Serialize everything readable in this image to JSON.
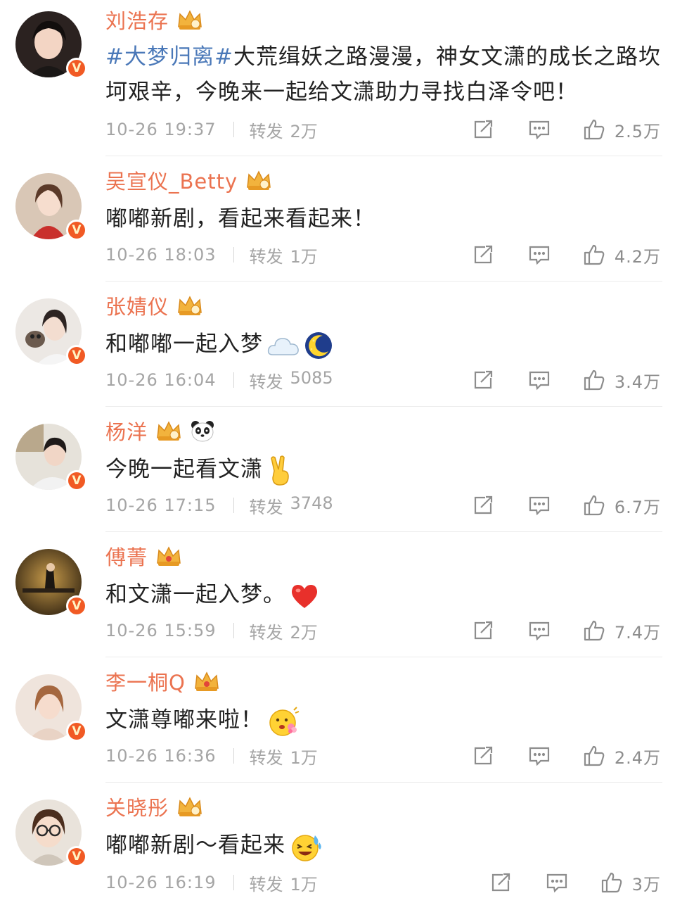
{
  "comments": [
    {
      "name": "刘浩存",
      "hashtag": "#大梦归离#",
      "text": "大荒缉妖之路漫漫，神女文潇的成长之路坎坷艰辛，今晚来一起给文潇助力寻找白泽令吧！",
      "emojis": [],
      "time": "10-26 19:37",
      "forward_label": "转发",
      "forward_count": "2万",
      "likes": "2.5万",
      "badge": "V"
    },
    {
      "name": "吴宣仪_Betty",
      "hashtag": "",
      "text": "嘟嘟新剧，看起来看起来！",
      "emojis": [],
      "time": "10-26 18:03",
      "forward_label": "转发",
      "forward_count": "1万",
      "likes": "4.2万",
      "badge": "V"
    },
    {
      "name": "张婧仪",
      "hashtag": "",
      "text": "和嘟嘟一起入梦",
      "emojis": [
        "cloud-emoji",
        "moon-emoji"
      ],
      "time": "10-26 16:04",
      "forward_label": "转发",
      "forward_count": "5085",
      "likes": "3.4万",
      "badge": "V"
    },
    {
      "name": "杨洋",
      "hashtag": "",
      "text": "今晚一起看文潇",
      "emojis": [
        "victory-hand-emoji"
      ],
      "time": "10-26 17:15",
      "forward_label": "转发",
      "forward_count": "3748",
      "likes": "6.7万",
      "badge": "V"
    },
    {
      "name": "傅菁",
      "hashtag": "",
      "text": "和文潇一起入梦。",
      "emojis": [
        "heart-emoji"
      ],
      "time": "10-26 15:59",
      "forward_label": "转发",
      "forward_count": "2万",
      "likes": "7.4万",
      "badge": "V"
    },
    {
      "name": "李一桐Q",
      "hashtag": "",
      "text": "文潇尊嘟来啦！",
      "emojis": [
        "flower-face-emoji"
      ],
      "time": "10-26 16:36",
      "forward_label": "转发",
      "forward_count": "1万",
      "likes": "2.4万",
      "badge": "V"
    },
    {
      "name": "关晓彤",
      "hashtag": "",
      "text": "嘟嘟新剧～看起来",
      "emojis": [
        "laughing-tears-emoji"
      ],
      "time": "10-26 16:19",
      "forward_label": "转发",
      "forward_count": "1万",
      "likes": "3万",
      "badge": "V"
    }
  ],
  "colors": {
    "name": "#eb7350",
    "hashtag": "#4a78b8",
    "text": "#222222",
    "meta": "#a5a5a5",
    "badge": "#f15a24",
    "crown": "#f2b33d"
  },
  "icons": {
    "share": "share-icon",
    "comment": "comment-icon",
    "like": "thumbs-up-icon",
    "crown": "crown-icon",
    "verified": "verified-badge-icon"
  }
}
